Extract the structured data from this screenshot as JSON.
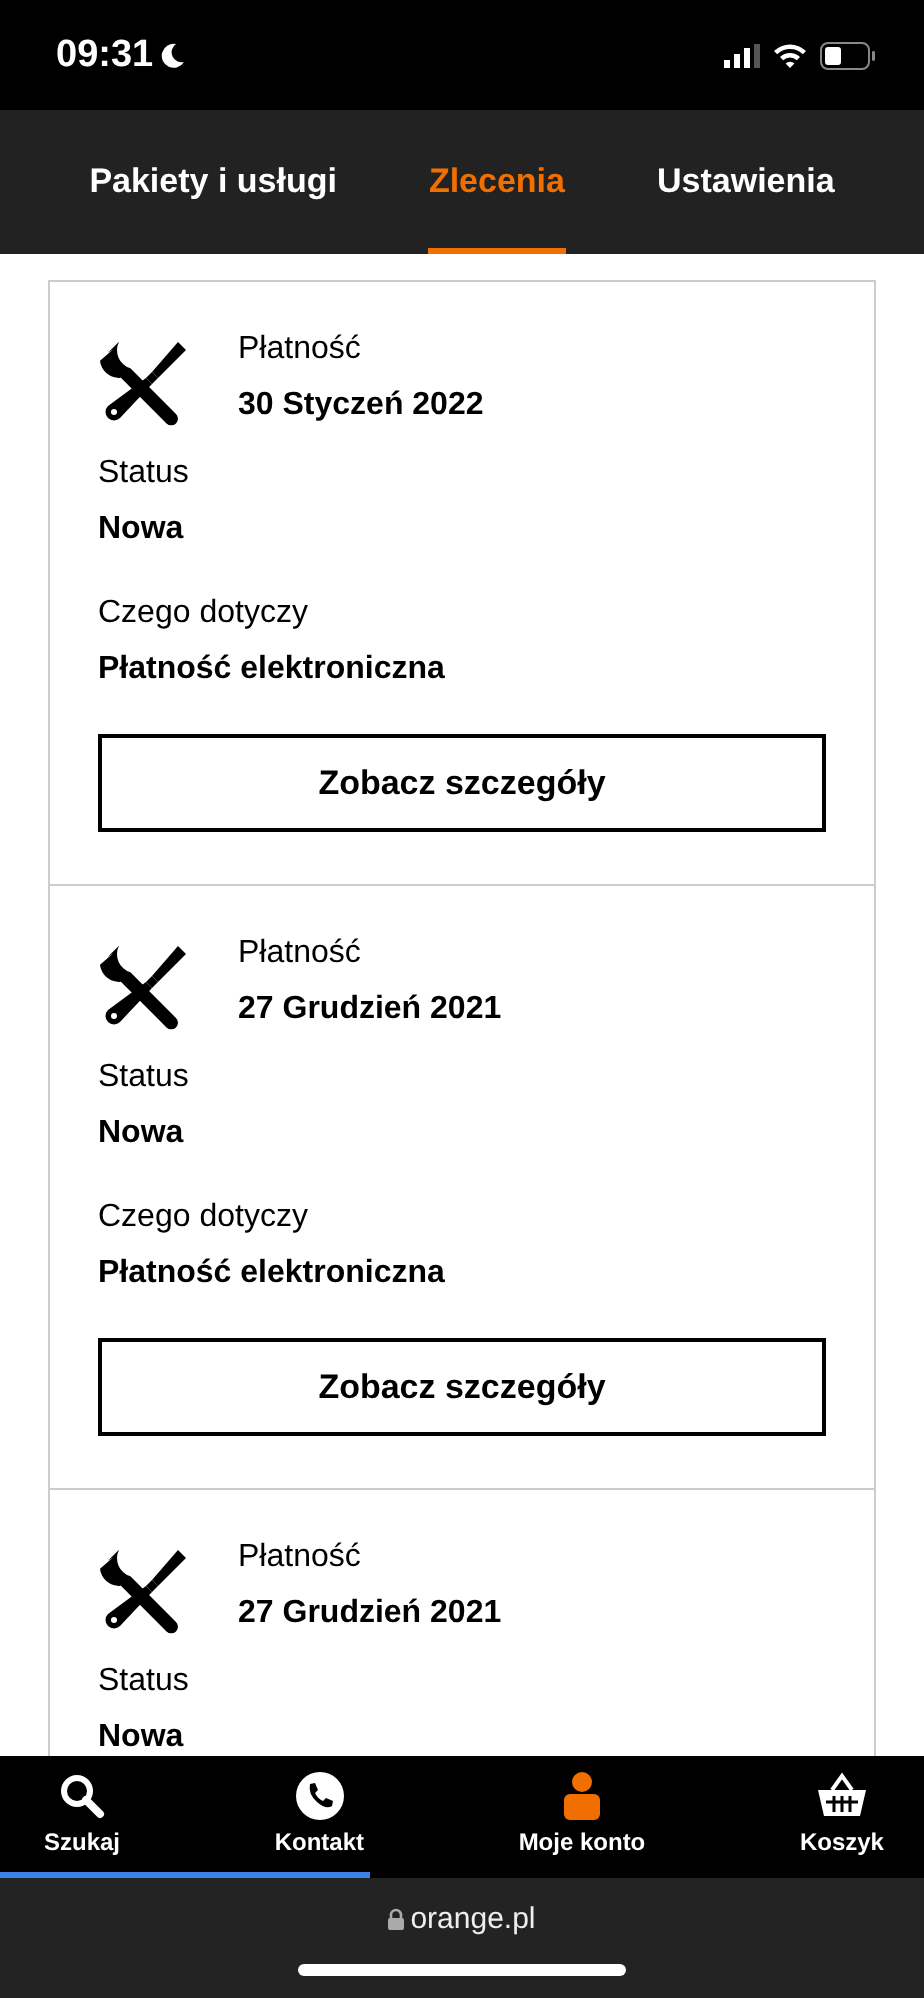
{
  "status_bar": {
    "time": "09:31"
  },
  "tabs": [
    {
      "label": "Pakiety i usługi",
      "selected": false
    },
    {
      "label": "Zlecenia",
      "selected": true
    },
    {
      "label": "Ustawienia",
      "selected": false
    }
  ],
  "orders": [
    {
      "type_label": "Płatność",
      "date": "30 Styczeń 2022",
      "status_label": "Status",
      "status": "Nowa",
      "subject_label": "Czego dotyczy",
      "subject": "Płatność elektroniczna",
      "button": "Zobacz szczegóły"
    },
    {
      "type_label": "Płatność",
      "date": "27 Grudzień 2021",
      "status_label": "Status",
      "status": "Nowa",
      "subject_label": "Czego dotyczy",
      "subject": "Płatność elektroniczna",
      "button": "Zobacz szczegóły"
    },
    {
      "type_label": "Płatność",
      "date": "27 Grudzień 2021",
      "status_label": "Status",
      "status": "Nowa"
    }
  ],
  "bottom_nav": [
    {
      "kind": "search",
      "label": "Szukaj",
      "selected": false
    },
    {
      "kind": "phone",
      "label": "Kontakt",
      "selected": false
    },
    {
      "kind": "person",
      "label": "Moje konto",
      "selected": true
    },
    {
      "kind": "basket",
      "label": "Koszyk",
      "selected": false
    }
  ],
  "page_load": {
    "level": 0.4
  },
  "browser": {
    "url": "orange.pl"
  }
}
